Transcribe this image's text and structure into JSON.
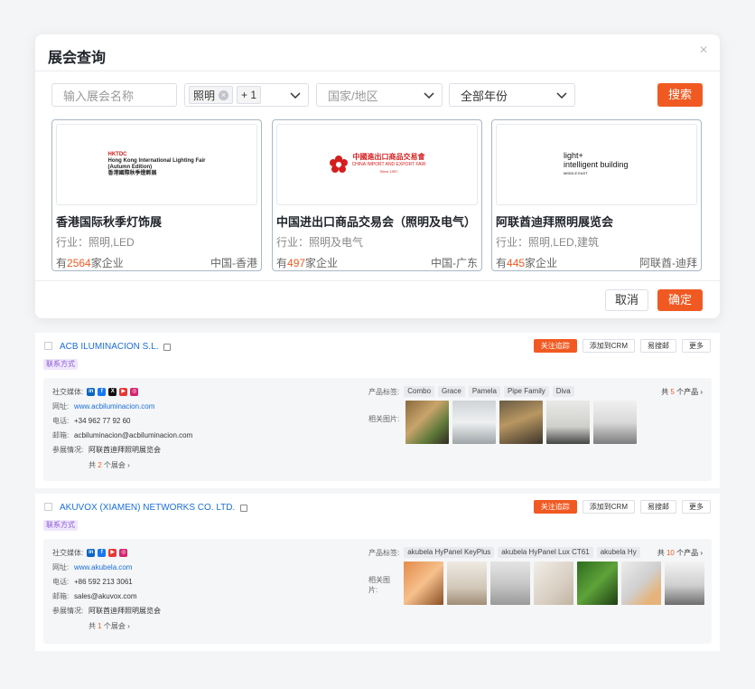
{
  "modal": {
    "title": "展会查询",
    "close_glyph": "×",
    "name_placeholder": "输入展会名称",
    "industry_tag": "照明",
    "industry_tag_remove": "×",
    "industry_more": "+ 1",
    "country_placeholder": "国家/地区",
    "year_value": "全部年份",
    "search_label": "搜索",
    "cancel_label": "取消",
    "confirm_label": "确定",
    "cards": [
      {
        "logo_top": "Hong Kong International Lighting Fair",
        "logo_mid": "(Autumn Edition)",
        "logo_bottom": "香港國際秋季燈飾展",
        "logo_brand": "HKTDC",
        "name": "香港国际秋季灯饰展",
        "industry": "行业：照明,LED",
        "count_prefix": "有",
        "count": "2564",
        "count_suffix": "家企业",
        "location": "中国-香港"
      },
      {
        "logo_top": "中國進出口商品交易會",
        "logo_mid": "CHINA IMPORT AND EXPORT FAIR",
        "logo_bottom": "Since 1957",
        "name": "中国进出口商品交易会（照明及电气）",
        "industry": "行业：照明及电气",
        "count_prefix": "有",
        "count": "497",
        "count_suffix": "家企业",
        "location": "中国-广东"
      },
      {
        "logo_top": "light+",
        "logo_mid": "intelligent building",
        "logo_bottom": "MIDDLE EAST",
        "name": "阿联酋迪拜照明展览会",
        "industry": "行业：照明,LED,建筑",
        "count_prefix": "有",
        "count": "445",
        "count_suffix": "家企业",
        "location": "阿联酋-迪拜"
      }
    ]
  },
  "companies": [
    {
      "name": "ACB ILUMINACION S.L.",
      "badge": "联系方式",
      "actions": [
        "关注追踪",
        "添加到CRM",
        "易搜邮",
        "更多"
      ],
      "social_label": "社交媒体:",
      "website_label": "网址:",
      "website": "www.acbiluminacion.com",
      "phone_label": "电话:",
      "phone": "+34 962 77 92 60",
      "email_label": "邮箱:",
      "email": "acbiluminacion@acbiluminacion.com",
      "fair_label": "参展情况:",
      "fair": "阿联酋迪拜照明展览会",
      "fair_total_prefix": "共",
      "fair_total": "2",
      "fair_total_suffix": "个展会",
      "tags_label": "产品标签:",
      "tags": [
        "Combo",
        "Grace",
        "Pamela",
        "Pipe Family",
        "Diva"
      ],
      "products_prefix": "共",
      "products_count": "5",
      "products_suffix": "个产品",
      "images_label": "相关图片:"
    },
    {
      "name": "AKUVOX (XIAMEN) NETWORKS CO. LTD.",
      "badge": "联系方式",
      "actions": [
        "关注追踪",
        "添加到CRM",
        "易搜邮",
        "更多"
      ],
      "social_label": "社交媒体:",
      "website_label": "网址:",
      "website": "www.akubela.com",
      "phone_label": "电话:",
      "phone": "+86 592 213 3061",
      "email_label": "邮箱:",
      "email": "sales@akuvox.com",
      "fair_label": "参展情况:",
      "fair": "阿联酋迪拜照明展览会",
      "fair_total_prefix": "共",
      "fair_total": "1",
      "fair_total_suffix": "个展会",
      "tags_label": "产品标签:",
      "tags": [
        "akubela HyPanel KeyPlus",
        "akubela HyPanel Lux CT61",
        "akubela Hy"
      ],
      "products_prefix": "共",
      "products_count": "10",
      "products_suffix": "个产品",
      "images_label": "相关图片:"
    }
  ],
  "colors": {
    "accent": "#f05a22",
    "link": "#1a6fd8",
    "badge": "#8a5ad6"
  },
  "icons": [
    "close-icon",
    "chevron-down-icon",
    "copy-icon",
    "linkedin-icon",
    "facebook-icon",
    "x-icon",
    "youtube-icon",
    "instagram-icon",
    "chevron-right-icon"
  ]
}
